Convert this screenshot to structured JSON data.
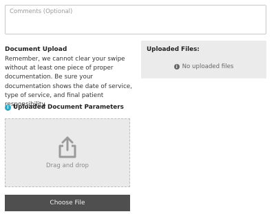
{
  "comments": {
    "placeholder": "Comments (Optional)"
  },
  "document_upload": {
    "title": "Document Upload",
    "description": "Remember, we cannot clear your swipe without at least one piece of proper documentation. Be sure your documentation shows the date of service, type of service, and final patient responsibility."
  },
  "parameters": {
    "info_icon": "i",
    "label": "Uploaded Document Parameters"
  },
  "dropzone": {
    "label": "Drag and drop",
    "icon": "upload-share-icon"
  },
  "choose_button": {
    "label": "Choose File"
  },
  "uploaded_files": {
    "title": "Uploaded Files:",
    "info_icon": "i",
    "empty_text": "No uploaded files"
  },
  "colors": {
    "info_accent": "#2aa9c9",
    "button_bg": "#4f4f4f",
    "panel_bg": "#ebebeb",
    "dropzone_bg": "#eaeaea"
  }
}
